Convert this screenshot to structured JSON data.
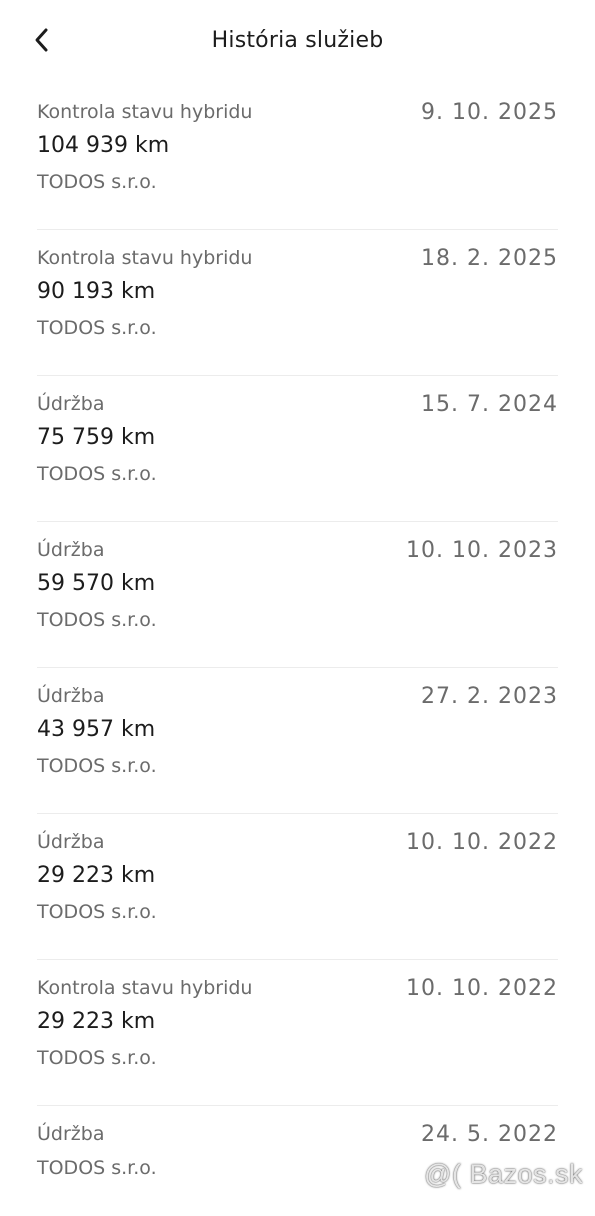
{
  "header": {
    "title": "História služieb",
    "back_icon": "chevron-left-icon"
  },
  "records": [
    {
      "type": "Kontrola stavu hybridu",
      "date": "9. 10. 2025",
      "km": "104 939 km",
      "dealer": "TODOS s.r.o."
    },
    {
      "type": "Kontrola stavu hybridu",
      "date": "18. 2. 2025",
      "km": "90 193 km",
      "dealer": "TODOS s.r.o."
    },
    {
      "type": "Údržba",
      "date": "15. 7. 2024",
      "km": "75 759 km",
      "dealer": "TODOS s.r.o."
    },
    {
      "type": "Údržba",
      "date": "10. 10. 2023",
      "km": "59 570 km",
      "dealer": "TODOS s.r.o."
    },
    {
      "type": "Údržba",
      "date": "27. 2. 2023",
      "km": "43 957 km",
      "dealer": "TODOS s.r.o."
    },
    {
      "type": "Údržba",
      "date": "10. 10. 2022",
      "km": "29 223 km",
      "dealer": "TODOS s.r.o."
    },
    {
      "type": "Kontrola stavu hybridu",
      "date": "10. 10. 2022",
      "km": "29 223 km",
      "dealer": "TODOS s.r.o."
    },
    {
      "type": "Údržba",
      "date": "24. 5. 2022",
      "dealer": "TODOS s.r.o."
    }
  ],
  "watermark": "@( Bazos.sk"
}
